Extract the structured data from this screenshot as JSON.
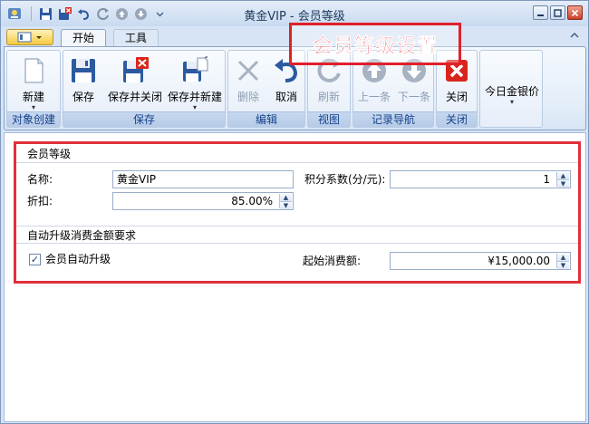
{
  "window": {
    "title": "黄金VIP - 会员等级"
  },
  "tabs": {
    "home": "开始",
    "tools": "工具"
  },
  "callout": {
    "text": "会员等级设置",
    "color": "#e0202a"
  },
  "ribbon": {
    "groups": {
      "create": "对象创建",
      "save": "保存",
      "edit": "编辑",
      "view": "视图",
      "nav": "记录导航",
      "close": "关闭"
    },
    "buttons": {
      "new": "新建",
      "save": "保存",
      "save_close": "保存并关闭",
      "save_new": "保存并新建",
      "delete": "删除",
      "cancel": "取消",
      "refresh": "刷新",
      "prev": "上一条",
      "next": "下一条",
      "close": "关闭",
      "gold_price": "今日金银价"
    }
  },
  "form": {
    "section_level": "会员等级",
    "name_label": "名称:",
    "name_value": "黄金VIP",
    "points_label": "积分系数(分/元):",
    "points_value": "1",
    "discount_label": "折扣:",
    "discount_value": "85.00%",
    "section_upgrade": "自动升级消费金额要求",
    "auto_upgrade_label": "会员自动升级",
    "auto_upgrade_checked": "✓",
    "start_amount_label": "起始消费额:",
    "start_amount_value": "¥15,000.00"
  }
}
